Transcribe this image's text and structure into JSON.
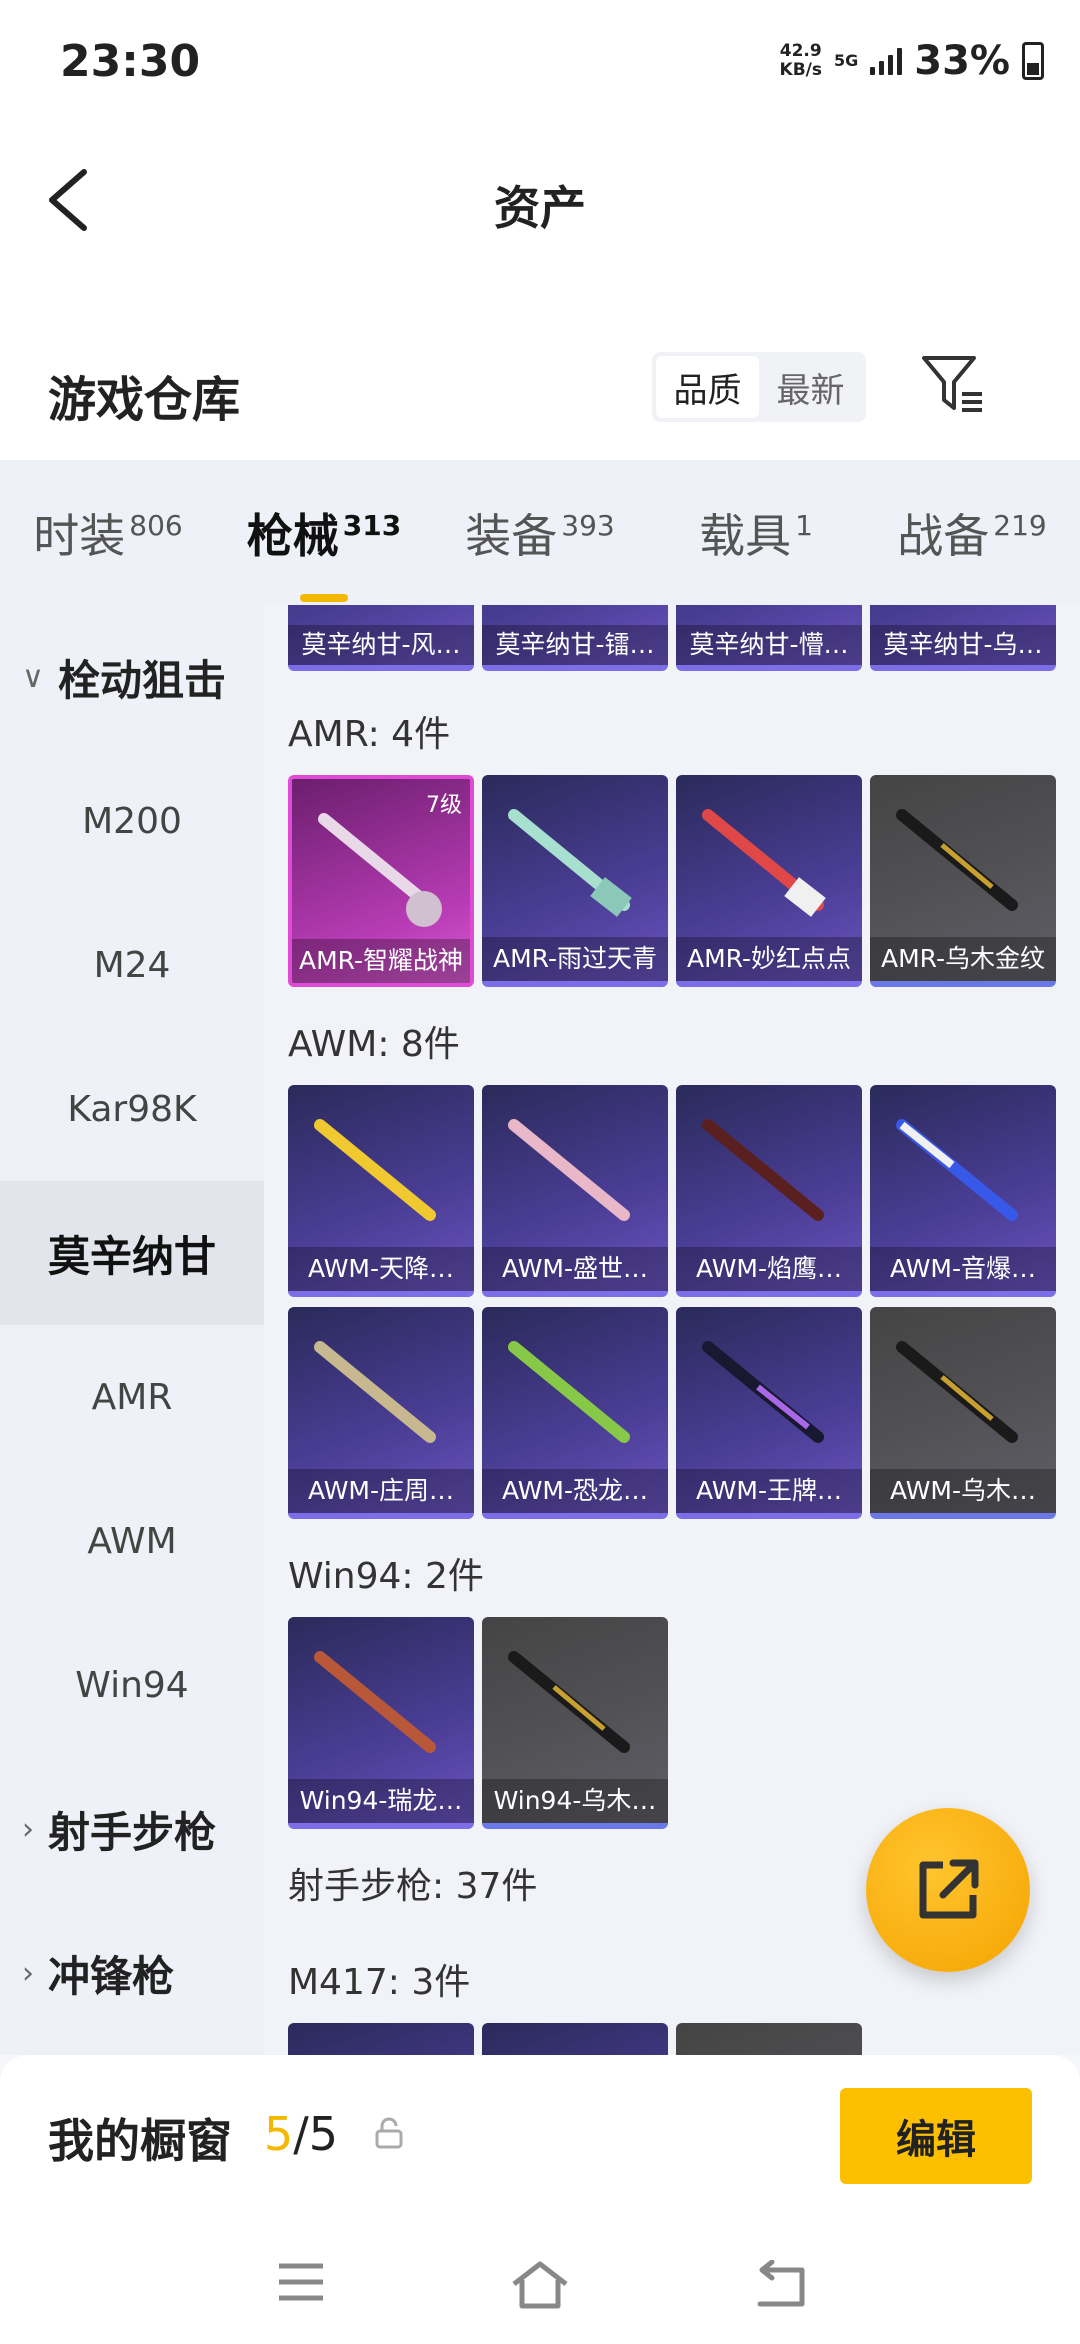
{
  "status": {
    "time": "23:30",
    "speed_value": "42.9",
    "speed_unit": "KB/s",
    "network": "5G",
    "battery": "33%"
  },
  "header": {
    "title": "资产"
  },
  "warehouse": {
    "title": "游戏仓库",
    "sort_quality": "品质",
    "sort_newest": "最新"
  },
  "tabs": [
    {
      "label": "时装",
      "count": "806"
    },
    {
      "label": "枪械",
      "count": "313"
    },
    {
      "label": "装备",
      "count": "393"
    },
    {
      "label": "载具",
      "count": "1"
    },
    {
      "label": "战备",
      "count": "219"
    }
  ],
  "sidebar": [
    {
      "label": "栓动狙击",
      "chev": "∨"
    },
    {
      "label": "M200"
    },
    {
      "label": "M24"
    },
    {
      "label": "Kar98K"
    },
    {
      "label": "莫辛纳甘"
    },
    {
      "label": "AMR"
    },
    {
      "label": "AWM"
    },
    {
      "label": "Win94"
    },
    {
      "label": "射手步枪",
      "chev": "›"
    },
    {
      "label": "冲锋枪",
      "chev": "›"
    }
  ],
  "groups": {
    "mosin_top": [
      "莫辛纳甘-风…",
      "莫辛纳甘-镭…",
      "莫辛纳甘-懵…",
      "莫辛纳甘-乌…"
    ],
    "amr_header": "AMR: 4件",
    "amr": [
      "AMR-智耀战神",
      "AMR-雨过天青",
      "AMR-妙红点点",
      "AMR-乌木金纹"
    ],
    "amr_level": "7级",
    "awm_header": "AWM: 8件",
    "awm": [
      "AWM-天降…",
      "AWM-盛世…",
      "AWM-焰鹰…",
      "AWM-音爆…",
      "AWM-庄周…",
      "AWM-恐龙…",
      "AWM-王牌…",
      "AWM-乌木…"
    ],
    "win94_header": "Win94: 2件",
    "win94": [
      "Win94-瑞龙…",
      "Win94-乌木…"
    ],
    "marksman_header": "射手步枪: 37件",
    "m417_header": "M417: 3件"
  },
  "bottom": {
    "showcase": "我的橱窗",
    "count_current": "5",
    "count_sep_total": "/5",
    "edit": "编辑"
  }
}
